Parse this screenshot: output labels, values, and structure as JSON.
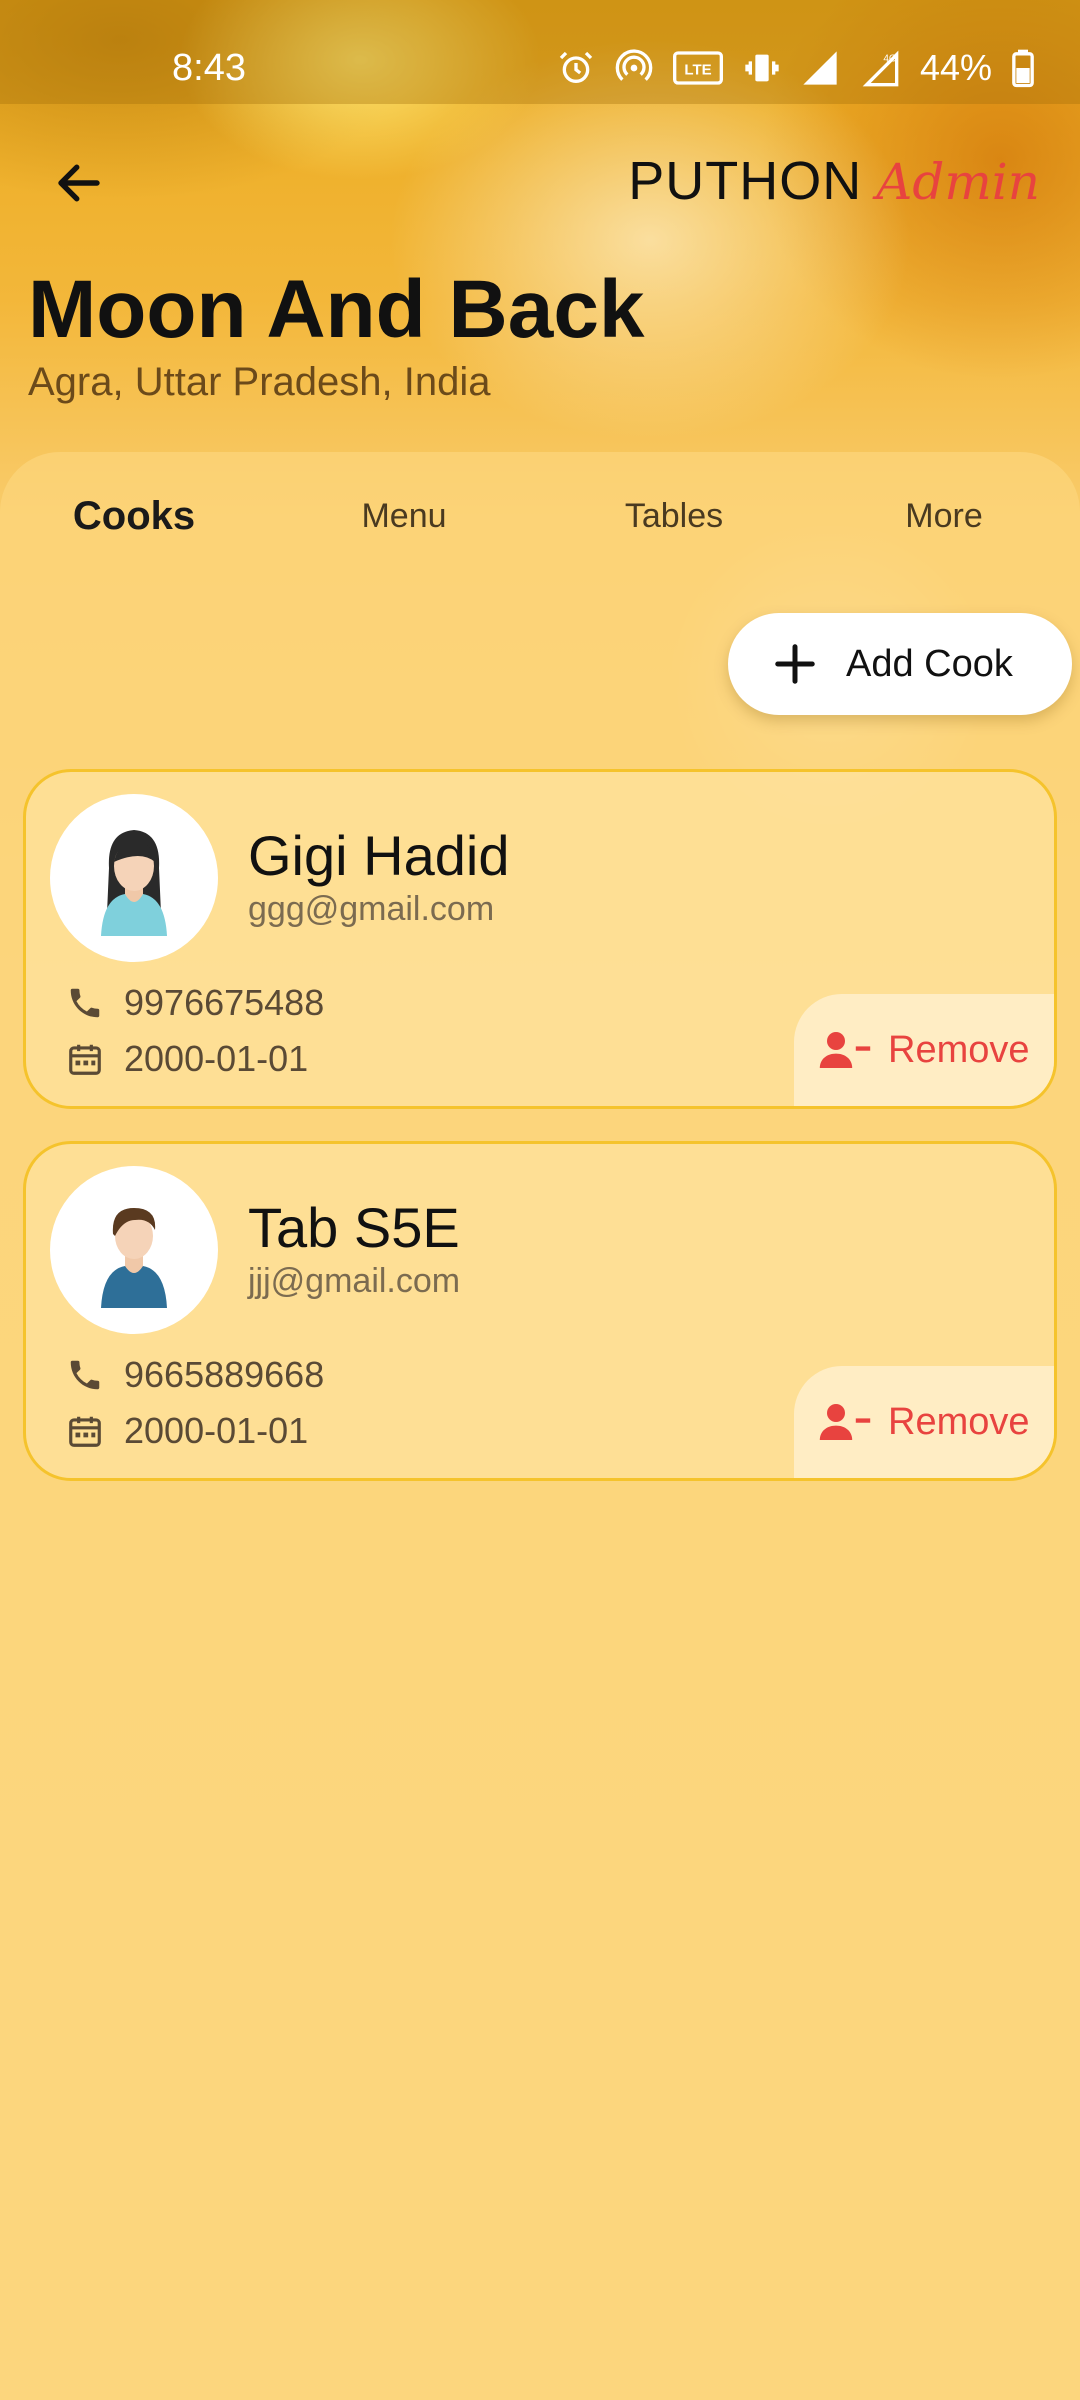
{
  "status_bar": {
    "time": "8:43",
    "battery": "44%",
    "icons": [
      "alarm-icon",
      "hotspot-icon",
      "volte-icon",
      "vibrate-icon",
      "signal-icon",
      "4g-signal-icon",
      "battery-icon"
    ]
  },
  "header": {
    "back_icon": "arrow-left-icon",
    "brand_main": "PUTHON",
    "brand_sub": "Admin"
  },
  "restaurant": {
    "name": "Moon And Back",
    "location": "Agra, Uttar Pradesh, India"
  },
  "tabs": [
    {
      "label": "Cooks",
      "active": true
    },
    {
      "label": "Menu",
      "active": false
    },
    {
      "label": "Tables",
      "active": false
    },
    {
      "label": "More",
      "active": false
    }
  ],
  "actions": {
    "add_cook_label": "Add Cook",
    "add_icon": "plus-icon"
  },
  "cooks": [
    {
      "name": "Gigi Hadid",
      "email": "ggg@gmail.com",
      "phone": "9976675488",
      "date": "2000-01-01",
      "avatar": "female-avatar",
      "remove_label": "Remove"
    },
    {
      "name": "Tab S5E",
      "email": "jjj@gmail.com",
      "phone": "9665889668",
      "date": "2000-01-01",
      "avatar": "male-avatar",
      "remove_label": "Remove"
    }
  ],
  "colors": {
    "accent_red": "#e8433f",
    "card_border": "#f5c32c",
    "background": "#fbd57e"
  }
}
